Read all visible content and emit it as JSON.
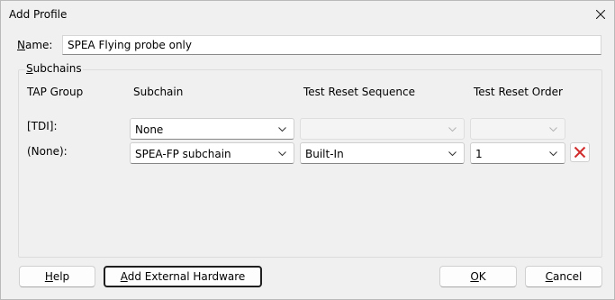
{
  "window": {
    "title": "Add Profile"
  },
  "name": {
    "label_first": "N",
    "label_rest": "ame:",
    "value": "SPEA Flying probe only"
  },
  "subchains": {
    "label_first": "S",
    "label_rest": "ubchains",
    "headers": {
      "tap_group": "TAP Group",
      "subchain": "Subchain",
      "reset_sequence": "Test Reset Sequence",
      "reset_order": "Test Reset Order"
    },
    "rows": [
      {
        "tap_group": "[TDI]:",
        "subchain": "None",
        "reset_sequence": "",
        "reset_order": ""
      },
      {
        "tap_group": "(None):",
        "subchain": "SPEA-FP subchain",
        "reset_sequence": "Built-In",
        "reset_order": "1"
      }
    ]
  },
  "buttons": {
    "help_first": "H",
    "help_rest": "elp",
    "add_hw_first": "A",
    "add_hw_rest": "dd External Hardware",
    "ok_first": "O",
    "ok_rest": "K",
    "cancel_first": "C",
    "cancel_rest": "ancel"
  },
  "icons": {
    "close": "close-icon",
    "dropdown": "chevron-down-icon",
    "delete": "delete-x-icon"
  },
  "colors": {
    "delete_icon": "#d12b2b",
    "background": "#f0f0f0"
  }
}
